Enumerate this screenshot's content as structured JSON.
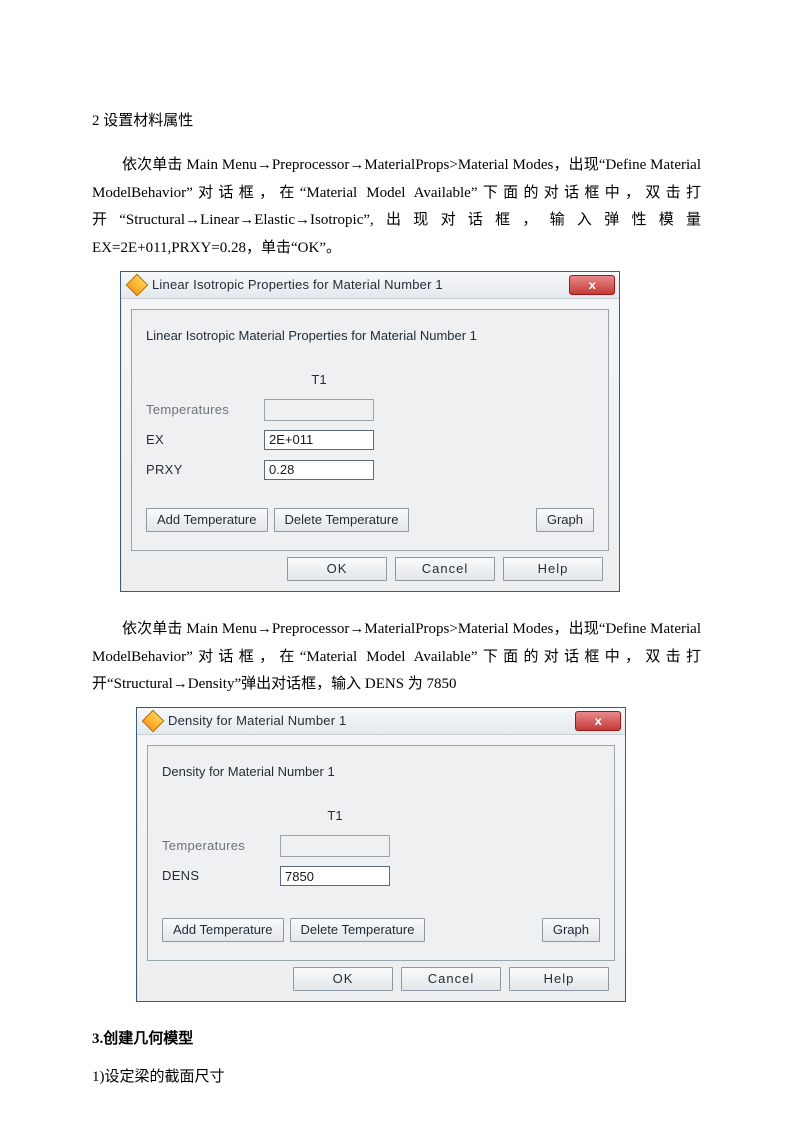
{
  "sections": {
    "mat": {
      "heading": "2 设置材料属性",
      "para1": "依次单击 Main Menu→Preprocessor→MaterialProps>Material Modes，出现“Define Material ModelBehavior”对话框，在“Material Model Available”下面的对话框中，双击打开“Structural→Linear→Elastic→Isotropic”,出现对话框，输入弹性模量 EX=2E+011,PRXY=0.28，单击“OK”。",
      "para2": "依次单击 Main Menu→Preprocessor→MaterialProps>Material Modes，出现“Define Material ModelBehavior”对话框，在“Material Model Available”下面的对话框中，双击打开“Structural→Density”弹出对话框，输入 DENS 为 7850"
    },
    "geom": {
      "heading": "3.创建几何模型",
      "sub1": "1)设定梁的截面尺寸"
    }
  },
  "dialog1": {
    "title": "Linear Isotropic Properties for Material Number 1",
    "heading": "Linear Isotropic Material Properties for Material Number 1",
    "colHead": "T1",
    "rowTemp": "Temperatures",
    "rowEX_label": "EX",
    "rowEX_value": "2E+011",
    "rowPRXY_label": "PRXY",
    "rowPRXY_value": "0.28",
    "btnAddTemp": "Add Temperature",
    "btnDelTemp": "Delete Temperature",
    "btnGraph": "Graph",
    "btnOK": "OK",
    "btnCancel": "Cancel",
    "btnHelp": "Help"
  },
  "dialog2": {
    "title": "Density for Material Number 1",
    "heading": "Density for Material Number 1",
    "colHead": "T1",
    "rowTemp": "Temperatures",
    "rowDENS_label": "DENS",
    "rowDENS_value": "7850",
    "btnAddTemp": "Add Temperature",
    "btnDelTemp": "Delete Temperature",
    "btnGraph": "Graph",
    "btnOK": "OK",
    "btnCancel": "Cancel",
    "btnHelp": "Help"
  }
}
